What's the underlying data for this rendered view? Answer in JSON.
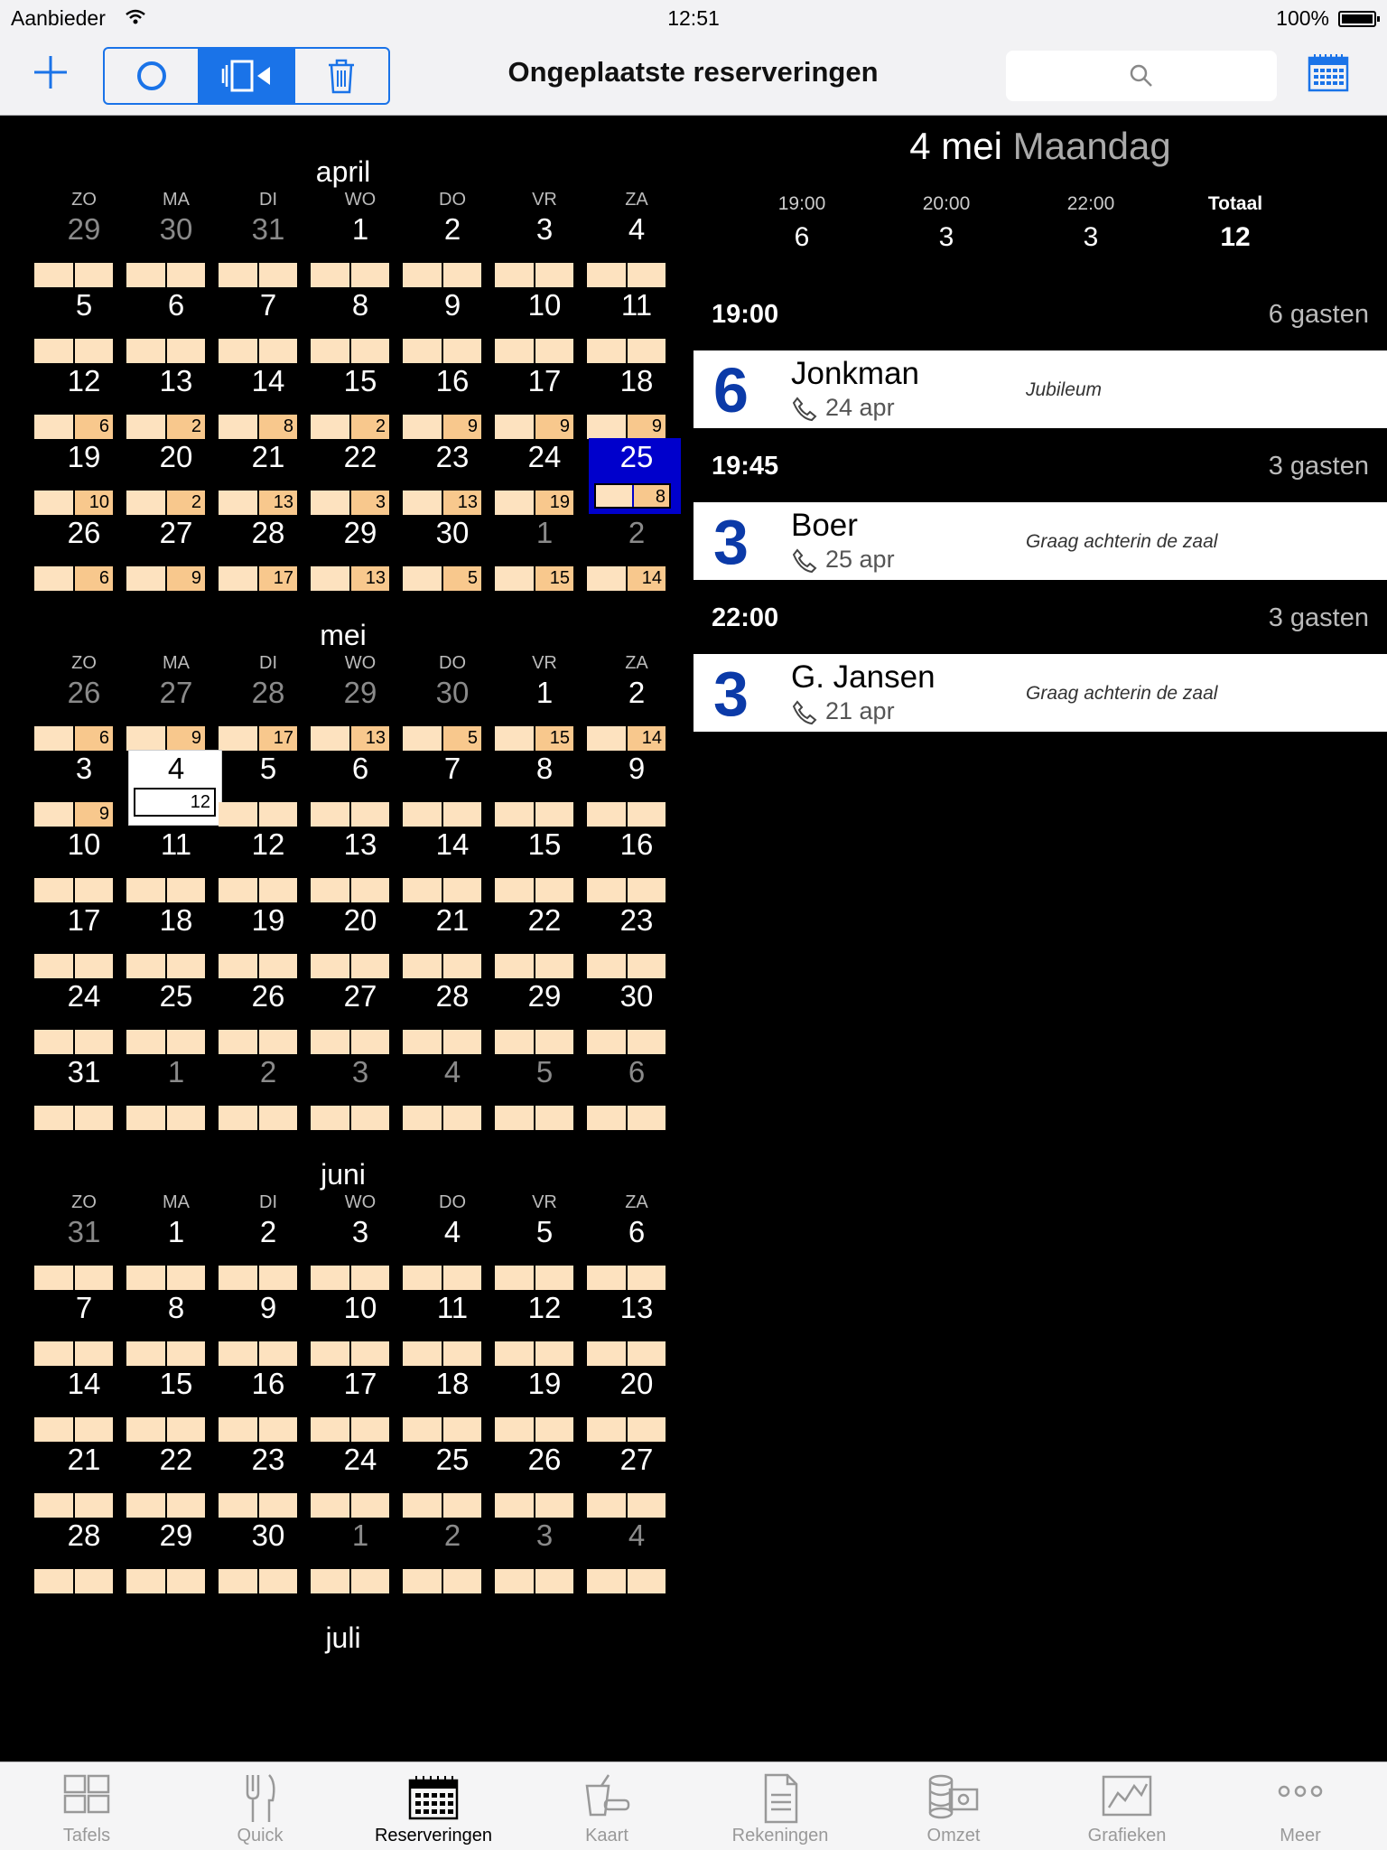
{
  "status": {
    "carrier": "Aanbieder",
    "time": "12:51",
    "battery": "100%"
  },
  "toolbar": {
    "title": "Ongeplaatste reserveringen"
  },
  "calendar": {
    "dow": [
      "ZO",
      "MA",
      "DI",
      "WO",
      "DO",
      "VR",
      "ZA"
    ],
    "months": [
      {
        "name": "april",
        "weeks": [
          [
            {
              "d": "29",
              "dim": true
            },
            {
              "d": "30",
              "dim": true
            },
            {
              "d": "31",
              "dim": true
            },
            {
              "d": "1"
            },
            {
              "d": "2"
            },
            {
              "d": "3"
            },
            {
              "d": "4"
            }
          ],
          [
            {
              "d": "5"
            },
            {
              "d": "6"
            },
            {
              "d": "7"
            },
            {
              "d": "8"
            },
            {
              "d": "9"
            },
            {
              "d": "10"
            },
            {
              "d": "11"
            }
          ],
          [
            {
              "d": "12",
              "v": "6"
            },
            {
              "d": "13",
              "v": "2"
            },
            {
              "d": "14",
              "v": "8"
            },
            {
              "d": "15",
              "v": "2"
            },
            {
              "d": "16",
              "v": "9"
            },
            {
              "d": "17",
              "v": "9"
            },
            {
              "d": "18",
              "v": "9"
            }
          ],
          [
            {
              "d": "19",
              "v": "10"
            },
            {
              "d": "20",
              "v": "2"
            },
            {
              "d": "21",
              "v": "13"
            },
            {
              "d": "22",
              "v": "3"
            },
            {
              "d": "23",
              "v": "13"
            },
            {
              "d": "24",
              "v": "19"
            },
            {
              "d": "25",
              "v": "8",
              "sel": "blue"
            }
          ],
          [
            {
              "d": "26",
              "v": "6"
            },
            {
              "d": "27",
              "v": "9"
            },
            {
              "d": "28",
              "v": "17"
            },
            {
              "d": "29",
              "v": "13"
            },
            {
              "d": "30",
              "v": "5"
            },
            {
              "d": "1",
              "v": "15",
              "dim": true
            },
            {
              "d": "2",
              "v": "14",
              "dim": true
            }
          ]
        ]
      },
      {
        "name": "mei",
        "weeks": [
          [
            {
              "d": "26",
              "v": "6",
              "dim": true
            },
            {
              "d": "27",
              "v": "9",
              "dim": true
            },
            {
              "d": "28",
              "v": "17",
              "dim": true
            },
            {
              "d": "29",
              "v": "13",
              "dim": true
            },
            {
              "d": "30",
              "v": "5",
              "dim": true
            },
            {
              "d": "1",
              "v": "15"
            },
            {
              "d": "2",
              "v": "14"
            }
          ],
          [
            {
              "d": "3",
              "v": "9"
            },
            {
              "d": "4",
              "v": "12",
              "sel": "white"
            },
            {
              "d": "5"
            },
            {
              "d": "6"
            },
            {
              "d": "7"
            },
            {
              "d": "8"
            },
            {
              "d": "9"
            }
          ],
          [
            {
              "d": "10"
            },
            {
              "d": "11"
            },
            {
              "d": "12"
            },
            {
              "d": "13"
            },
            {
              "d": "14"
            },
            {
              "d": "15"
            },
            {
              "d": "16"
            }
          ],
          [
            {
              "d": "17"
            },
            {
              "d": "18"
            },
            {
              "d": "19"
            },
            {
              "d": "20"
            },
            {
              "d": "21"
            },
            {
              "d": "22"
            },
            {
              "d": "23"
            }
          ],
          [
            {
              "d": "24"
            },
            {
              "d": "25"
            },
            {
              "d": "26"
            },
            {
              "d": "27"
            },
            {
              "d": "28"
            },
            {
              "d": "29"
            },
            {
              "d": "30"
            }
          ],
          [
            {
              "d": "31"
            },
            {
              "d": "1",
              "dim": true
            },
            {
              "d": "2",
              "dim": true
            },
            {
              "d": "3",
              "dim": true
            },
            {
              "d": "4",
              "dim": true
            },
            {
              "d": "5",
              "dim": true
            },
            {
              "d": "6",
              "dim": true
            }
          ]
        ]
      },
      {
        "name": "juni",
        "weeks": [
          [
            {
              "d": "31",
              "dim": true
            },
            {
              "d": "1"
            },
            {
              "d": "2"
            },
            {
              "d": "3"
            },
            {
              "d": "4"
            },
            {
              "d": "5"
            },
            {
              "d": "6"
            }
          ],
          [
            {
              "d": "7"
            },
            {
              "d": "8"
            },
            {
              "d": "9"
            },
            {
              "d": "10"
            },
            {
              "d": "11"
            },
            {
              "d": "12"
            },
            {
              "d": "13"
            }
          ],
          [
            {
              "d": "14"
            },
            {
              "d": "15"
            },
            {
              "d": "16"
            },
            {
              "d": "17"
            },
            {
              "d": "18"
            },
            {
              "d": "19"
            },
            {
              "d": "20"
            }
          ],
          [
            {
              "d": "21"
            },
            {
              "d": "22"
            },
            {
              "d": "23"
            },
            {
              "d": "24"
            },
            {
              "d": "25"
            },
            {
              "d": "26"
            },
            {
              "d": "27"
            }
          ],
          [
            {
              "d": "28"
            },
            {
              "d": "29"
            },
            {
              "d": "30"
            },
            {
              "d": "1",
              "dim": true
            },
            {
              "d": "2",
              "dim": true
            },
            {
              "d": "3",
              "dim": true
            },
            {
              "d": "4",
              "dim": true
            }
          ]
        ]
      },
      {
        "name": "juli",
        "weeks": []
      }
    ]
  },
  "detail": {
    "date": "4 mei",
    "weekday": "Maandag",
    "totals": [
      {
        "label": "19:00",
        "value": "6"
      },
      {
        "label": "20:00",
        "value": "3"
      },
      {
        "label": "22:00",
        "value": "3"
      },
      {
        "label": "Totaal",
        "value": "12"
      }
    ],
    "slots": [
      {
        "time": "19:00",
        "guests": "6 gasten",
        "res": {
          "count": "6",
          "name": "Jonkman",
          "date": "24 apr",
          "note": "Jubileum"
        }
      },
      {
        "time": "19:45",
        "guests": "3 gasten",
        "res": {
          "count": "3",
          "name": "Boer",
          "date": "25 apr",
          "note": "Graag achterin de zaal"
        }
      },
      {
        "time": "22:00",
        "guests": "3 gasten",
        "res": {
          "count": "3",
          "name": "G. Jansen",
          "date": "21 apr",
          "note": "Graag achterin de zaal"
        }
      }
    ]
  },
  "tabs": [
    {
      "label": "Tafels",
      "icon": "tables-icon"
    },
    {
      "label": "Quick",
      "icon": "cutlery-icon"
    },
    {
      "label": "Reserveringen",
      "icon": "calendar-icon",
      "active": true
    },
    {
      "label": "Kaart",
      "icon": "drink-icon"
    },
    {
      "label": "Rekeningen",
      "icon": "document-icon"
    },
    {
      "label": "Omzet",
      "icon": "coins-icon"
    },
    {
      "label": "Grafieken",
      "icon": "graph-icon"
    },
    {
      "label": "Meer",
      "icon": "more-icon"
    }
  ]
}
